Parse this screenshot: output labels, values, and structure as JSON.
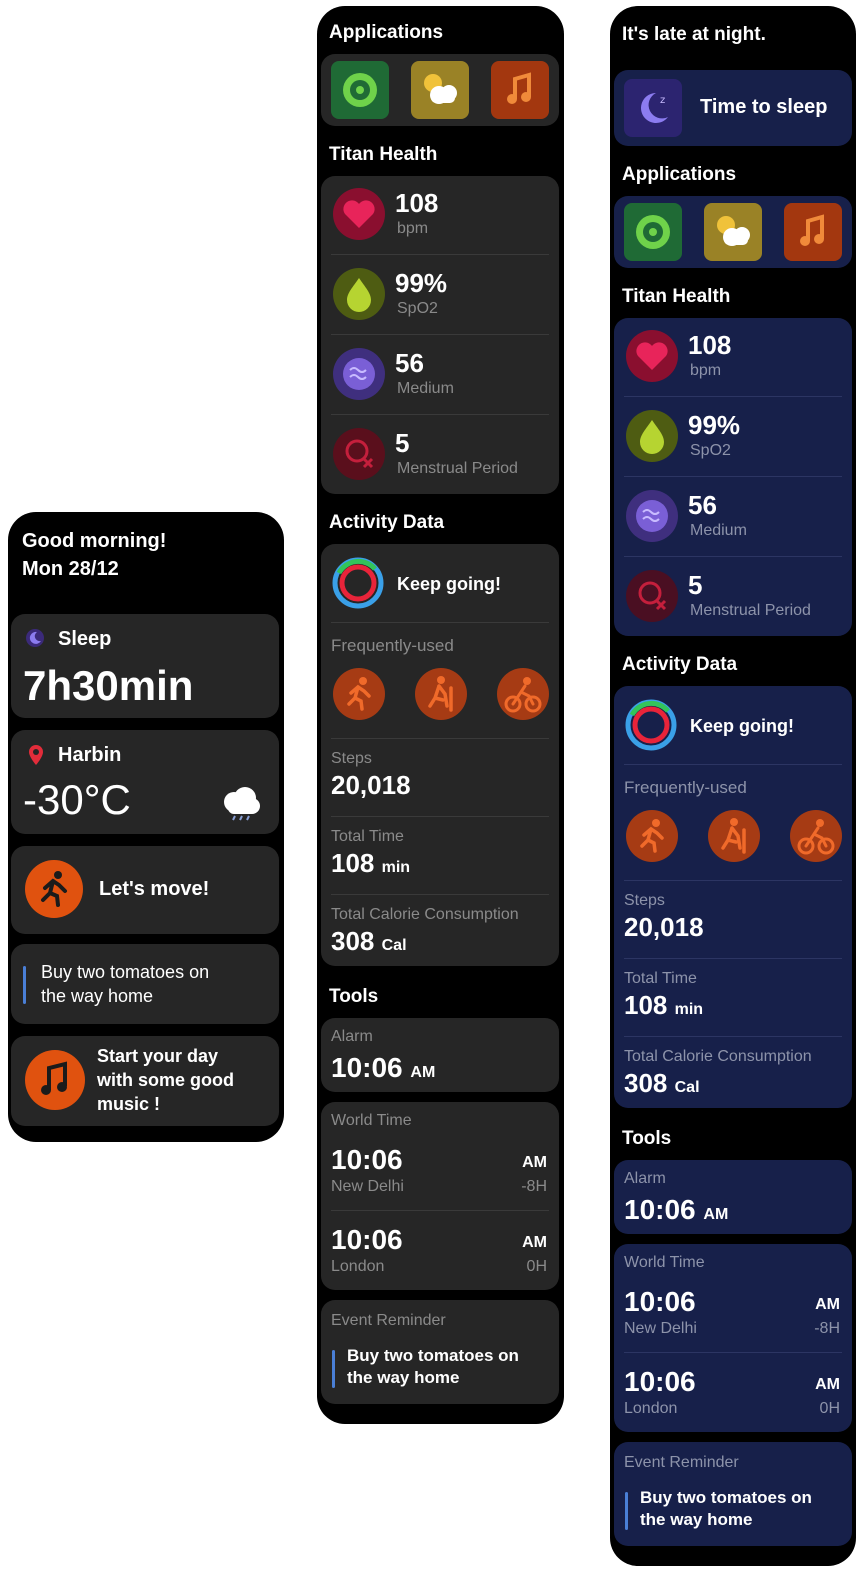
{
  "watch1": {
    "greeting": "Good morning!",
    "date": "Mon  28/12",
    "sleep": {
      "label": "Sleep",
      "value": "7h30min"
    },
    "weather": {
      "city": "Harbin",
      "temp": "-30°C"
    },
    "move": {
      "label": "Let's move!"
    },
    "reminder": {
      "line1": "Buy two tomatoes on",
      "line2": "the way home"
    },
    "music": {
      "line1": "Start your day",
      "line2": "with some good",
      "line3": "music !"
    }
  },
  "common": {
    "applications_title": "Applications",
    "health_title": "Titan Health",
    "heart": {
      "value": "108",
      "label": "bpm"
    },
    "spo2": {
      "value": "99%",
      "label": "SpO2"
    },
    "stress": {
      "value": "56",
      "label": "Medium"
    },
    "period": {
      "value": "5",
      "label": "Menstrual Period"
    },
    "activity_title": "Activity Data",
    "keep_going": "Keep going!",
    "frequently_used": "Frequently-used",
    "steps": {
      "label": "Steps",
      "value": "20,018"
    },
    "total_time": {
      "label": "Total Time",
      "value": "108",
      "unit": "min"
    },
    "calories": {
      "label": "Total Calorie Consumption",
      "value": "308",
      "unit": "Cal"
    },
    "tools_title": "Tools",
    "alarm": {
      "label": "Alarm",
      "time": "10:06",
      "ampm": "AM"
    },
    "world_time": {
      "label": "World Time",
      "cities": [
        {
          "time": "10:06",
          "ampm": "AM",
          "city": "New Delhi",
          "offset": "-8H"
        },
        {
          "time": "10:06",
          "ampm": "AM",
          "city": "London",
          "offset": "0H"
        }
      ]
    },
    "event": {
      "label": "Event Reminder",
      "line1": "Buy two tomatoes on",
      "line2": "the way home"
    }
  },
  "watch3": {
    "header": "It's late at night.",
    "sleep_prompt": "Time to sleep"
  },
  "colors": {
    "card_dark": "#262626",
    "card_navy": "#17204a",
    "orange": "#e0520f",
    "heart": "#d6194f",
    "spo2": "#a9c92a",
    "stress": "#7a5fd6",
    "period": "#c41f3c",
    "accent_blue": "#4a7fd6"
  },
  "icons": [
    "moon-icon",
    "location-pin-icon",
    "cloud-icon",
    "running-icon",
    "music-note-icon",
    "mindfulness-app-icon",
    "weather-app-icon",
    "music-app-icon",
    "heart-icon",
    "spo2-drop-icon",
    "stress-icon",
    "period-icon",
    "activity-rings-icon",
    "hiking-icon",
    "cycling-icon"
  ]
}
